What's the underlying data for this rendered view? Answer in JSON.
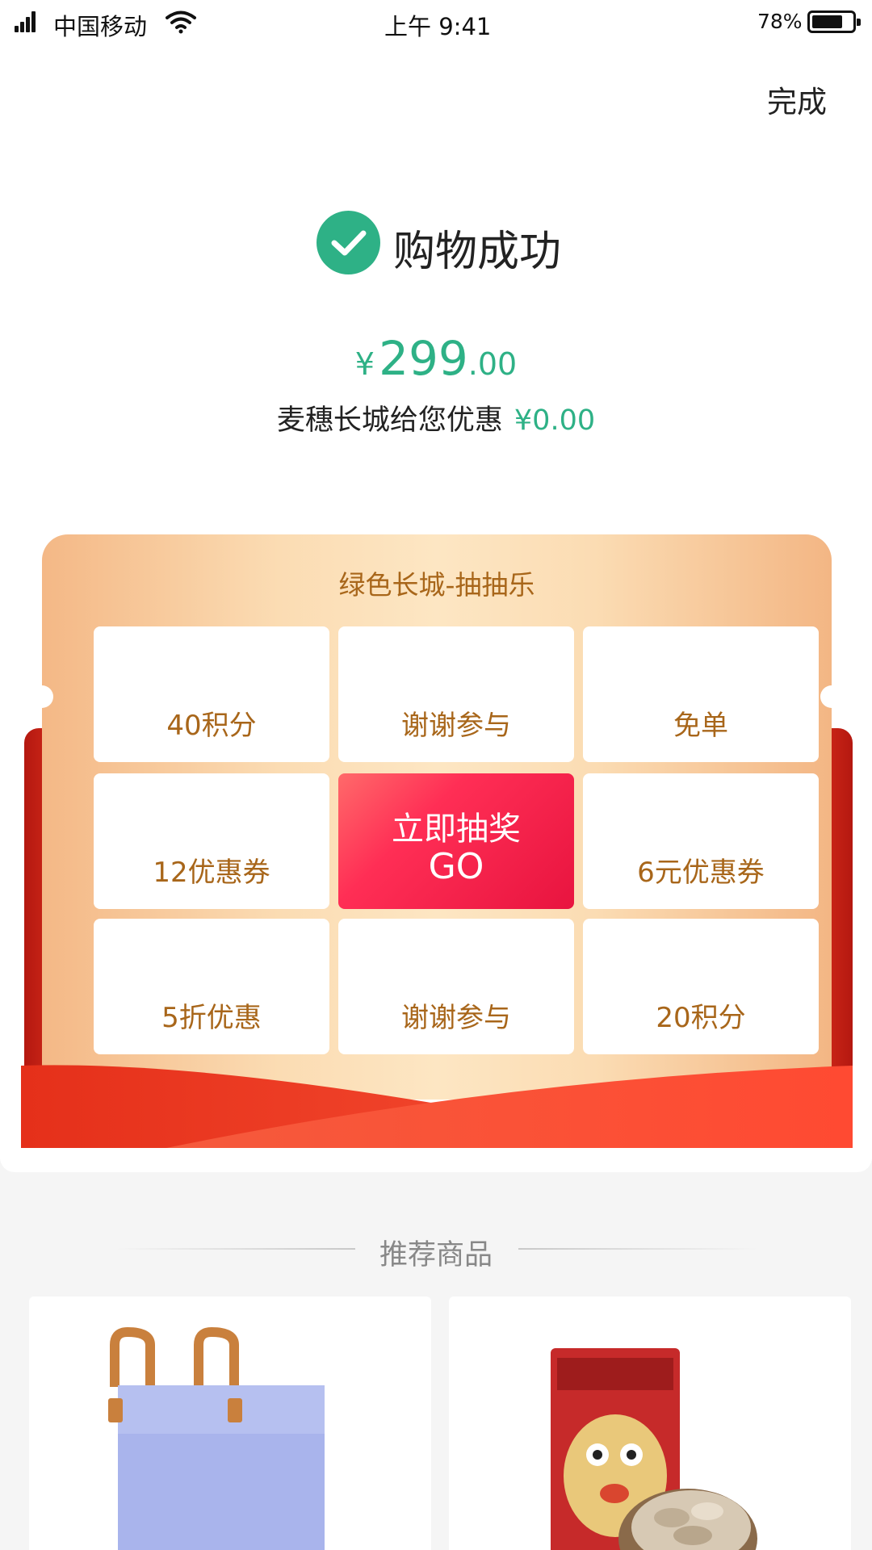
{
  "status_bar": {
    "carrier": "中国移动",
    "time": "上午 9:41",
    "battery": "78%",
    "battery_level": 0.78
  },
  "header": {
    "done_label": "完成"
  },
  "result": {
    "title": "购物成功",
    "currency": "¥",
    "amount_int": "299",
    "amount_dec": ".00",
    "discount_label": "麦穗长城给您优惠",
    "discount_value": "¥0.00"
  },
  "lottery": {
    "title": "绿色长城-抽抽乐",
    "prizes": [
      "40积分",
      "谢谢参与",
      "免单",
      "12优惠券",
      "6元优惠券",
      "5折优惠",
      "谢谢参与",
      "20积分"
    ],
    "go_line1": "立即抽奖",
    "go_line2": "GO"
  },
  "recommend": {
    "title": "推荐商品",
    "products": [
      {
        "icon": "laptop-bag-image",
        "color": "#a9b4ec"
      },
      {
        "icon": "snack-package-image",
        "color": "#c62a2a"
      }
    ]
  },
  "colors": {
    "accent": "#2eb186",
    "prize_text": "#a8661a",
    "go_button": "#ff2e55"
  }
}
